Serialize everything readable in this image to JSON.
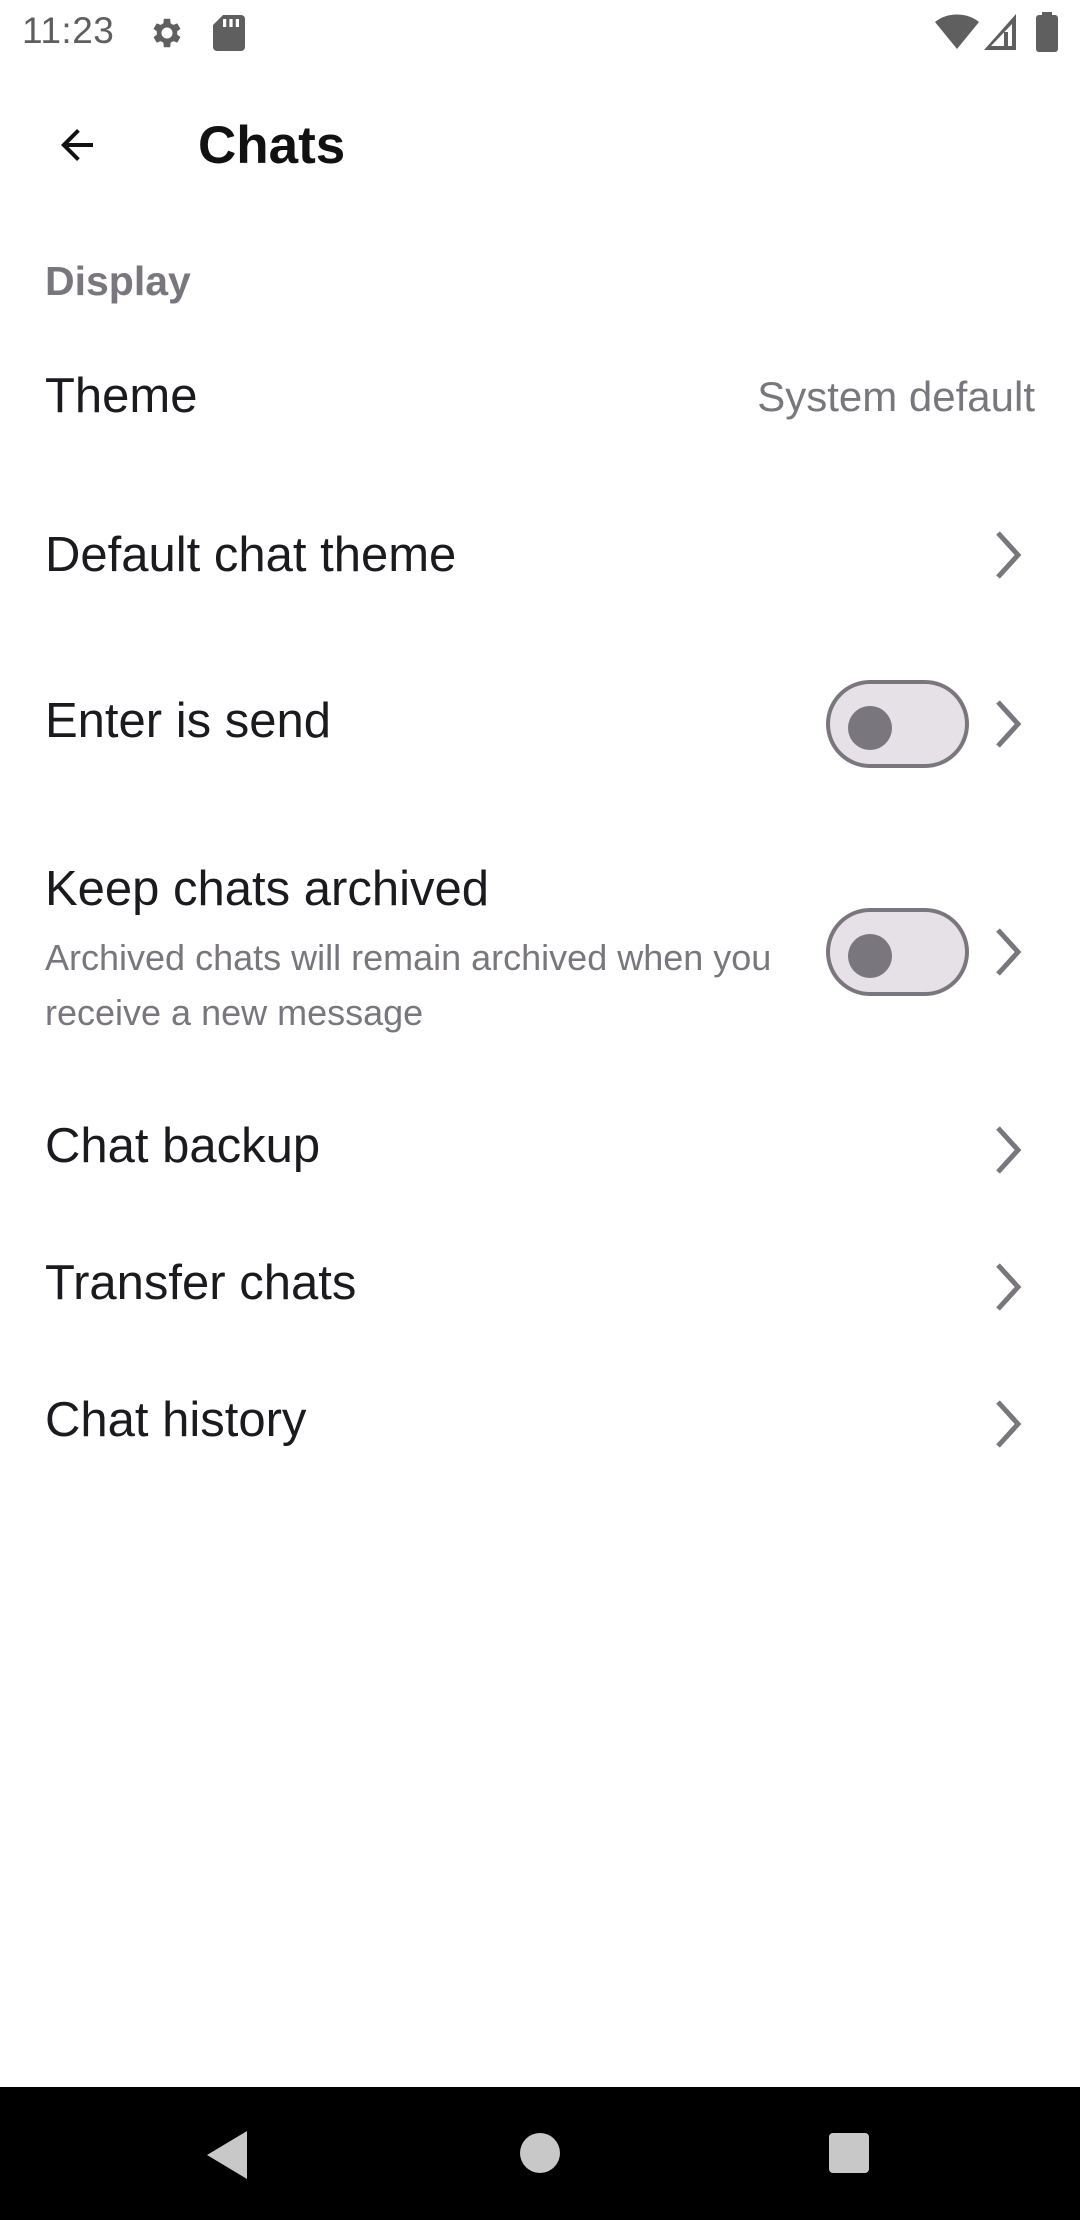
{
  "status_bar": {
    "time": "11:23",
    "icons": [
      "gear-icon",
      "sd-card-icon",
      "wifi-icon",
      "cell-signal-icon",
      "battery-icon"
    ]
  },
  "app_bar": {
    "title": "Chats",
    "back_icon": "arrow-back-icon"
  },
  "section": {
    "header": "Display"
  },
  "settings": [
    {
      "label": "Theme",
      "value": "System default"
    },
    {
      "label": "Default chat theme"
    },
    {
      "label": "Enter is send",
      "toggle": false
    },
    {
      "label": "Keep chats archived",
      "subtitle": "Archived chats will remain archived when you receive a new message",
      "toggle": false
    },
    {
      "label": "Chat backup"
    },
    {
      "label": "Transfer chats"
    },
    {
      "label": "Chat history"
    }
  ],
  "nav_bar": {
    "icons": [
      "back-triangle-icon",
      "home-circle-icon",
      "recents-square-icon"
    ]
  },
  "colors": {
    "text_primary": "#1b1b1f",
    "text_secondary": "#79767d",
    "toggle_track": "#e6e1e6",
    "nav_bar": "#000000"
  }
}
